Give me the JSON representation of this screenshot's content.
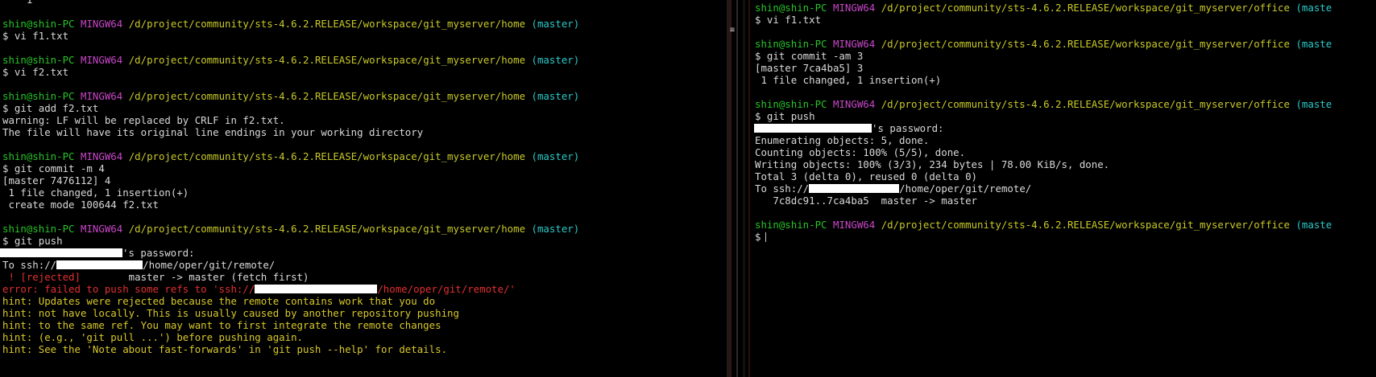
{
  "left": {
    "top_partial": "1",
    "prompt": {
      "user": "shin@shin-PC",
      "system": "MINGW64",
      "path": "/d/project/community/sts-4.6.2.RELEASE/workspace/git_myserver/home",
      "branch": "(master)"
    },
    "cmd1": "$ vi f1.txt",
    "cmd2": "$ vi f2.txt",
    "cmd3": "$ git add f2.txt",
    "warn1": "warning: LF will be replaced by CRLF in f2.txt.",
    "warn2": "The file will have its original line endings in your working directory",
    "cmd4": "$ git commit -m 4",
    "commit1": "[master 7476112] 4",
    "commit2": " 1 file changed, 1 insertion(+)",
    "commit3": " create mode 100644 f2.txt",
    "cmd5": "$ git push",
    "password_suffix": "'s password:",
    "to_prefix": "To ssh://",
    "to_suffix": "/home/oper/git/remote/",
    "rejected_tag": " ! [rejected]",
    "rejected_rest": "        master -> master (fetch first)",
    "error_prefix": "error: failed to push some refs to 'ssh://",
    "error_suffix": "/home/oper/git/remote/'",
    "hints": [
      "hint: Updates were rejected because the remote contains work that you do",
      "hint: not have locally. This is usually caused by another repository pushing",
      "hint: to the same ref. You may want to first integrate the remote changes",
      "hint: (e.g., 'git pull ...') before pushing again.",
      "hint: See the 'Note about fast-forwards' in 'git push --help' for details."
    ]
  },
  "right": {
    "prompt": {
      "user": "shin@shin-PC",
      "system": "MINGW64",
      "path": "/d/project/community/sts-4.6.2.RELEASE/workspace/git_myserver/office",
      "branch": "(maste"
    },
    "cmd1": "$ vi f1.txt",
    "cmd2": "$ git commit -am 3",
    "commit1": "[master 7ca4ba5] 3",
    "commit2": " 1 file changed, 1 insertion(+)",
    "cmd3": "$ git push",
    "password_suffix": "'s password:",
    "enum": "Enumerating objects: 5, done.",
    "count": "Counting objects: 100% (5/5), done.",
    "write": "Writing objects: 100% (3/3), 234 bytes | 78.00 KiB/s, done.",
    "total": "Total 3 (delta 0), reused 0 (delta 0)",
    "to_prefix": "To ssh://",
    "to_suffix": "/home/oper/git/remote/",
    "range": "   7c8dc91..7ca4ba5  master -> master",
    "final_prompt": "$"
  },
  "colors": {
    "background": "#000000",
    "user": "#27c427",
    "system": "#c846c8",
    "path": "#c8c829",
    "branch": "#2ac9c9",
    "error": "#e03030",
    "hint": "#d8c82a",
    "text": "#d9d9d9"
  }
}
